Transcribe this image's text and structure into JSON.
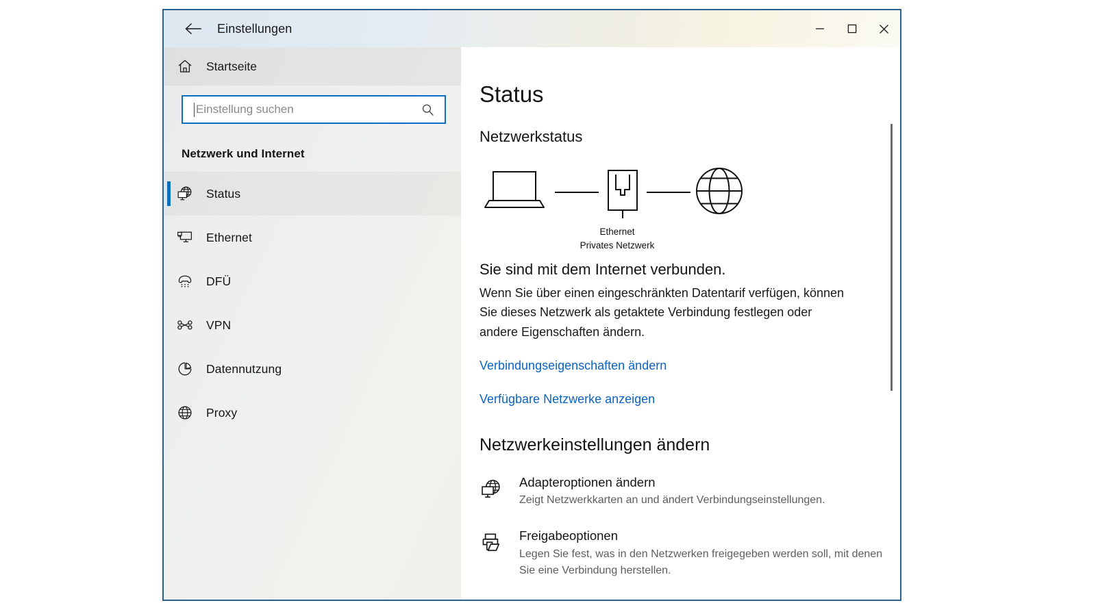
{
  "window": {
    "title": "Einstellungen",
    "back_icon": "back-arrow-icon",
    "controls": {
      "minimize": "minimize-icon",
      "maximize": "maximize-icon",
      "close": "close-icon"
    }
  },
  "sidebar": {
    "home": {
      "label": "Startseite",
      "icon": "home-icon"
    },
    "search": {
      "placeholder": "Einstellung suchen",
      "value": "",
      "icon": "search-icon"
    },
    "category": "Netzwerk und Internet",
    "items": [
      {
        "label": "Status",
        "icon": "globe-monitor-icon",
        "selected": true
      },
      {
        "label": "Ethernet",
        "icon": "monitor-ethernet-icon",
        "selected": false
      },
      {
        "label": "DFÜ",
        "icon": "dialup-phone-icon",
        "selected": false
      },
      {
        "label": "VPN",
        "icon": "vpn-key-icon",
        "selected": false
      },
      {
        "label": "Datennutzung",
        "icon": "pie-chart-icon",
        "selected": false
      },
      {
        "label": "Proxy",
        "icon": "globe-icon",
        "selected": false
      }
    ]
  },
  "main": {
    "page_title": "Status",
    "section_heading": "Netzwerkstatus",
    "diagram": {
      "device_icon": "laptop-icon",
      "adapter_icon": "ethernet-port-icon",
      "internet_icon": "globe-icon",
      "adapter_label": "Ethernet",
      "adapter_sublabel": "Privates Netzwerk"
    },
    "status_headline": "Sie sind mit dem Internet verbunden.",
    "status_paragraph": "Wenn Sie über einen eingeschränkten Datentarif verfügen, können Sie dieses Netzwerk als getaktete Verbindung festlegen oder andere Eigenschaften ändern.",
    "links": [
      "Verbindungseigenschaften ändern",
      "Verfügbare Netzwerke anzeigen"
    ],
    "settings_heading": "Netzwerkeinstellungen ändern",
    "options": [
      {
        "icon": "globe-monitor-icon",
        "title": "Adapteroptionen ändern",
        "description": "Zeigt Netzwerkkarten an und ändert Verbindungseinstellungen."
      },
      {
        "icon": "share-folder-icon",
        "title": "Freigabeoptionen",
        "description": "Legen Sie fest, was in den Netzwerken freigegeben werden soll, mit denen Sie eine Verbindung herstellen."
      }
    ]
  },
  "colors": {
    "accent": "#0a6ebd",
    "link": "#0b63c5",
    "window_border": "#2a6191",
    "search_focus_border": "#0d6cc4"
  }
}
